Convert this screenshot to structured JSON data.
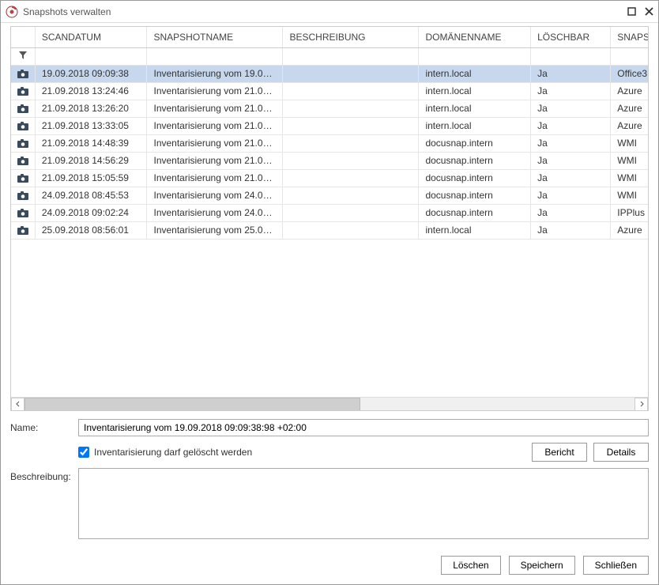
{
  "window": {
    "title": "Snapshots verwalten"
  },
  "columns": {
    "scan": "SCANDATUM",
    "name": "SNAPSHOTNAME",
    "desc": "BESCHREIBUNG",
    "domain": "DOMÄNENNAME",
    "deletable": "LÖSCHBAR",
    "snap": "SNAPS"
  },
  "rows": [
    {
      "scan": "19.09.2018 09:09:38",
      "name": "Inventarisierung vom 19.09.2...",
      "desc": "",
      "domain": "intern.local",
      "deletable": "Ja",
      "snap": "Office3",
      "selected": true
    },
    {
      "scan": "21.09.2018 13:24:46",
      "name": "Inventarisierung vom 21.09.2...",
      "desc": "",
      "domain": "intern.local",
      "deletable": "Ja",
      "snap": "Azure"
    },
    {
      "scan": "21.09.2018 13:26:20",
      "name": "Inventarisierung vom 21.09.2...",
      "desc": "",
      "domain": "intern.local",
      "deletable": "Ja",
      "snap": "Azure"
    },
    {
      "scan": "21.09.2018 13:33:05",
      "name": "Inventarisierung vom 21.09.2...",
      "desc": "",
      "domain": "intern.local",
      "deletable": "Ja",
      "snap": "Azure"
    },
    {
      "scan": "21.09.2018 14:48:39",
      "name": "Inventarisierung vom 21.09.2...",
      "desc": "",
      "domain": "docusnap.intern",
      "deletable": "Ja",
      "snap": "WMI"
    },
    {
      "scan": "21.09.2018 14:56:29",
      "name": "Inventarisierung vom 21.09.2...",
      "desc": "",
      "domain": "docusnap.intern",
      "deletable": "Ja",
      "snap": "WMI"
    },
    {
      "scan": "21.09.2018 15:05:59",
      "name": "Inventarisierung vom 21.09.2...",
      "desc": "",
      "domain": "docusnap.intern",
      "deletable": "Ja",
      "snap": "WMI"
    },
    {
      "scan": "24.09.2018 08:45:53",
      "name": "Inventarisierung vom 24.09.2...",
      "desc": "",
      "domain": "docusnap.intern",
      "deletable": "Ja",
      "snap": "WMI"
    },
    {
      "scan": "24.09.2018 09:02:24",
      "name": "Inventarisierung vom 24.09.2...",
      "desc": "",
      "domain": "docusnap.intern",
      "deletable": "Ja",
      "snap": "IPPlus"
    },
    {
      "scan": "25.09.2018 08:56:01",
      "name": "Inventarisierung vom 25.09.2...",
      "desc": "",
      "domain": "intern.local",
      "deletable": "Ja",
      "snap": "Azure"
    }
  ],
  "form": {
    "name_label": "Name:",
    "name_value": "Inventarisierung vom 19.09.2018 09:09:38:98 +02:00",
    "deletable_label": "Inventarisierung darf gelöscht werden",
    "deletable_checked": true,
    "desc_label": "Beschreibung:",
    "desc_value": ""
  },
  "buttons": {
    "report": "Bericht",
    "details": "Details",
    "delete": "Löschen",
    "save": "Speichern",
    "close": "Schließen"
  }
}
